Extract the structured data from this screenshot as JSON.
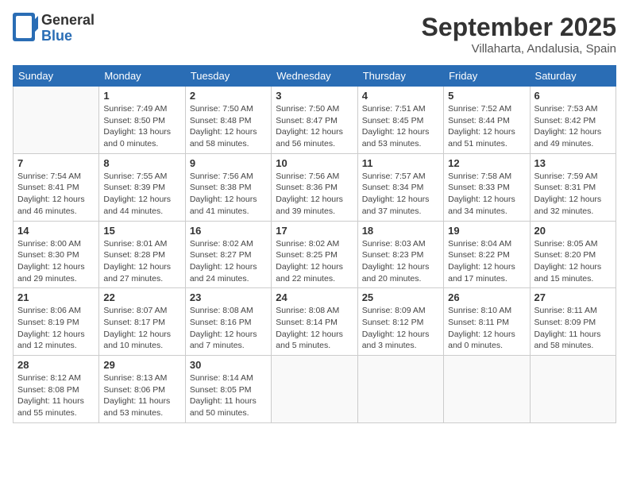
{
  "header": {
    "logo_general": "General",
    "logo_blue": "Blue",
    "month_title": "September 2025",
    "location": "Villaharta, Andalusia, Spain"
  },
  "days_of_week": [
    "Sunday",
    "Monday",
    "Tuesday",
    "Wednesday",
    "Thursday",
    "Friday",
    "Saturday"
  ],
  "weeks": [
    [
      {
        "day": "",
        "info": ""
      },
      {
        "day": "1",
        "info": "Sunrise: 7:49 AM\nSunset: 8:50 PM\nDaylight: 13 hours\nand 0 minutes."
      },
      {
        "day": "2",
        "info": "Sunrise: 7:50 AM\nSunset: 8:48 PM\nDaylight: 12 hours\nand 58 minutes."
      },
      {
        "day": "3",
        "info": "Sunrise: 7:50 AM\nSunset: 8:47 PM\nDaylight: 12 hours\nand 56 minutes."
      },
      {
        "day": "4",
        "info": "Sunrise: 7:51 AM\nSunset: 8:45 PM\nDaylight: 12 hours\nand 53 minutes."
      },
      {
        "day": "5",
        "info": "Sunrise: 7:52 AM\nSunset: 8:44 PM\nDaylight: 12 hours\nand 51 minutes."
      },
      {
        "day": "6",
        "info": "Sunrise: 7:53 AM\nSunset: 8:42 PM\nDaylight: 12 hours\nand 49 minutes."
      }
    ],
    [
      {
        "day": "7",
        "info": "Sunrise: 7:54 AM\nSunset: 8:41 PM\nDaylight: 12 hours\nand 46 minutes."
      },
      {
        "day": "8",
        "info": "Sunrise: 7:55 AM\nSunset: 8:39 PM\nDaylight: 12 hours\nand 44 minutes."
      },
      {
        "day": "9",
        "info": "Sunrise: 7:56 AM\nSunset: 8:38 PM\nDaylight: 12 hours\nand 41 minutes."
      },
      {
        "day": "10",
        "info": "Sunrise: 7:56 AM\nSunset: 8:36 PM\nDaylight: 12 hours\nand 39 minutes."
      },
      {
        "day": "11",
        "info": "Sunrise: 7:57 AM\nSunset: 8:34 PM\nDaylight: 12 hours\nand 37 minutes."
      },
      {
        "day": "12",
        "info": "Sunrise: 7:58 AM\nSunset: 8:33 PM\nDaylight: 12 hours\nand 34 minutes."
      },
      {
        "day": "13",
        "info": "Sunrise: 7:59 AM\nSunset: 8:31 PM\nDaylight: 12 hours\nand 32 minutes."
      }
    ],
    [
      {
        "day": "14",
        "info": "Sunrise: 8:00 AM\nSunset: 8:30 PM\nDaylight: 12 hours\nand 29 minutes."
      },
      {
        "day": "15",
        "info": "Sunrise: 8:01 AM\nSunset: 8:28 PM\nDaylight: 12 hours\nand 27 minutes."
      },
      {
        "day": "16",
        "info": "Sunrise: 8:02 AM\nSunset: 8:27 PM\nDaylight: 12 hours\nand 24 minutes."
      },
      {
        "day": "17",
        "info": "Sunrise: 8:02 AM\nSunset: 8:25 PM\nDaylight: 12 hours\nand 22 minutes."
      },
      {
        "day": "18",
        "info": "Sunrise: 8:03 AM\nSunset: 8:23 PM\nDaylight: 12 hours\nand 20 minutes."
      },
      {
        "day": "19",
        "info": "Sunrise: 8:04 AM\nSunset: 8:22 PM\nDaylight: 12 hours\nand 17 minutes."
      },
      {
        "day": "20",
        "info": "Sunrise: 8:05 AM\nSunset: 8:20 PM\nDaylight: 12 hours\nand 15 minutes."
      }
    ],
    [
      {
        "day": "21",
        "info": "Sunrise: 8:06 AM\nSunset: 8:19 PM\nDaylight: 12 hours\nand 12 minutes."
      },
      {
        "day": "22",
        "info": "Sunrise: 8:07 AM\nSunset: 8:17 PM\nDaylight: 12 hours\nand 10 minutes."
      },
      {
        "day": "23",
        "info": "Sunrise: 8:08 AM\nSunset: 8:16 PM\nDaylight: 12 hours\nand 7 minutes."
      },
      {
        "day": "24",
        "info": "Sunrise: 8:08 AM\nSunset: 8:14 PM\nDaylight: 12 hours\nand 5 minutes."
      },
      {
        "day": "25",
        "info": "Sunrise: 8:09 AM\nSunset: 8:12 PM\nDaylight: 12 hours\nand 3 minutes."
      },
      {
        "day": "26",
        "info": "Sunrise: 8:10 AM\nSunset: 8:11 PM\nDaylight: 12 hours\nand 0 minutes."
      },
      {
        "day": "27",
        "info": "Sunrise: 8:11 AM\nSunset: 8:09 PM\nDaylight: 11 hours\nand 58 minutes."
      }
    ],
    [
      {
        "day": "28",
        "info": "Sunrise: 8:12 AM\nSunset: 8:08 PM\nDaylight: 11 hours\nand 55 minutes."
      },
      {
        "day": "29",
        "info": "Sunrise: 8:13 AM\nSunset: 8:06 PM\nDaylight: 11 hours\nand 53 minutes."
      },
      {
        "day": "30",
        "info": "Sunrise: 8:14 AM\nSunset: 8:05 PM\nDaylight: 11 hours\nand 50 minutes."
      },
      {
        "day": "",
        "info": ""
      },
      {
        "day": "",
        "info": ""
      },
      {
        "day": "",
        "info": ""
      },
      {
        "day": "",
        "info": ""
      }
    ]
  ]
}
